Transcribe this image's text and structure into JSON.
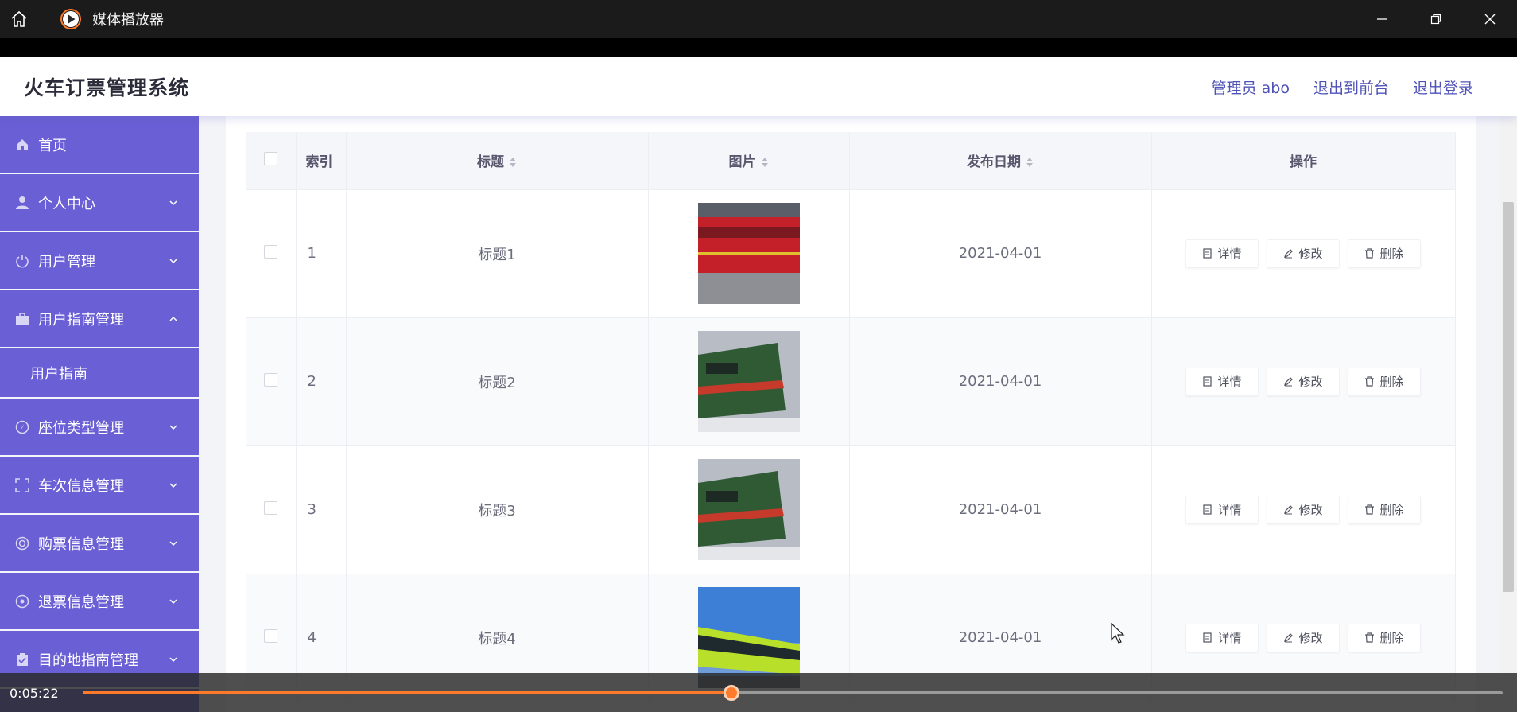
{
  "window": {
    "app_title": "媒体播放器",
    "accent_color": "#ff7a2b"
  },
  "header": {
    "system_title": "火车订票管理系统",
    "admin_label": "管理员 abo",
    "front_label": "退出到前台",
    "logout_label": "退出登录"
  },
  "sidebar": {
    "bg_color": "#6a5fd4",
    "items": [
      {
        "label": "首页",
        "icon": "home-icon"
      },
      {
        "label": "个人中心",
        "icon": "user-icon"
      },
      {
        "label": "用户管理",
        "icon": "power-icon"
      },
      {
        "label": "用户指南管理",
        "icon": "briefcase-icon"
      },
      {
        "label": "用户指南",
        "icon": ""
      },
      {
        "label": "座位类型管理",
        "icon": "compass-icon"
      },
      {
        "label": "车次信息管理",
        "icon": "fullscreen-icon"
      },
      {
        "label": "购票信息管理",
        "icon": "lifebuoy-icon"
      },
      {
        "label": "退票信息管理",
        "icon": "settings-icon"
      },
      {
        "label": "目的地指南管理",
        "icon": "clipboard-icon"
      }
    ]
  },
  "table": {
    "columns": {
      "index": "索引",
      "title": "标题",
      "image": "图片",
      "date": "发布日期",
      "ops": "操作"
    },
    "rows": [
      {
        "index": "1",
        "title": "标题1",
        "date": "2021-04-01",
        "image": "red-train"
      },
      {
        "index": "2",
        "title": "标题2",
        "date": "2021-04-01",
        "image": "green-locomotive"
      },
      {
        "index": "3",
        "title": "标题3",
        "date": "2021-04-01",
        "image": "green-locomotive"
      },
      {
        "index": "4",
        "title": "标题4",
        "date": "2021-04-01",
        "image": "green-tram"
      }
    ],
    "actions": {
      "detail": "详情",
      "edit": "修改",
      "delete": "删除"
    }
  },
  "player": {
    "current_time": "0:05:22",
    "progress": 0.457
  }
}
